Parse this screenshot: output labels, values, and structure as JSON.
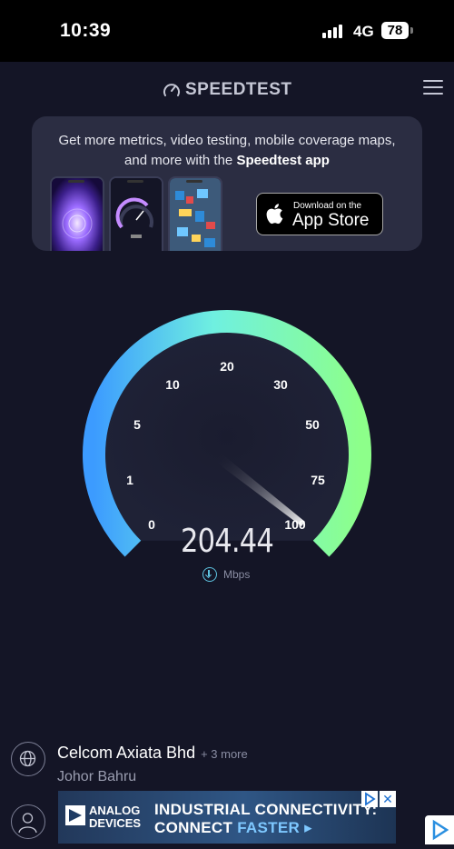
{
  "status_bar": {
    "time": "10:39",
    "network": "4G",
    "battery": "78"
  },
  "header": {
    "logo_text": "SPEEDTEST"
  },
  "promo": {
    "line1": "Get more metrics, video testing, mobile coverage maps,",
    "line2_prefix": "and more with the ",
    "line2_bold": "Speedtest app",
    "appstore_small": "Download on the",
    "appstore_big": "App Store"
  },
  "gauge": {
    "tick_labels": [
      "0",
      "1",
      "5",
      "10",
      "20",
      "30",
      "50",
      "75",
      "100"
    ],
    "speed": "204.44",
    "unit": "Mbps",
    "colors": {
      "start": "#3c9bff",
      "mid": "#6ff0e0",
      "end": "#8dff8a"
    }
  },
  "provider": {
    "name": "Celcom Axiata Bhd",
    "more": "+ 3 more",
    "location": "Johor Bahru"
  },
  "ad": {
    "brand_line1": "ANALOG",
    "brand_line2": "DEVICES",
    "headline1": "INDUSTRIAL CONNECTIVITY:",
    "headline2_prefix": "CONNECT ",
    "headline2_accent": "FASTER ▸",
    "close": "✕"
  }
}
